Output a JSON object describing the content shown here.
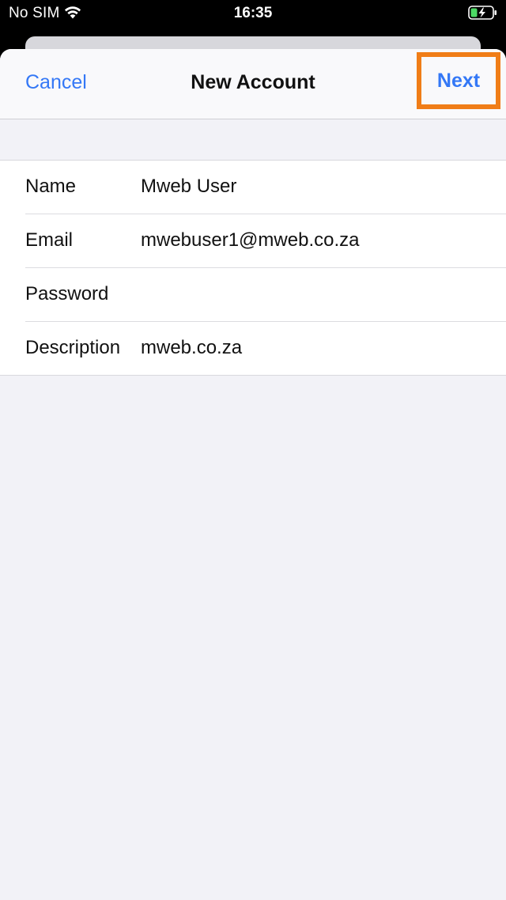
{
  "status_bar": {
    "carrier": "No SIM",
    "time": "16:35",
    "icons": [
      "wifi-icon",
      "battery-charging-icon"
    ]
  },
  "nav": {
    "cancel_label": "Cancel",
    "title": "New Account",
    "next_label": "Next"
  },
  "form": {
    "rows": [
      {
        "label": "Name",
        "value": "Mweb User"
      },
      {
        "label": "Email",
        "value": "mwebuser1@mweb.co.za"
      },
      {
        "label": "Password",
        "value": ""
      },
      {
        "label": "Description",
        "value": "mweb.co.za"
      }
    ]
  },
  "colors": {
    "accent": "#3478f6",
    "highlight": "#f07d17",
    "battery_charge": "#4cd964"
  }
}
